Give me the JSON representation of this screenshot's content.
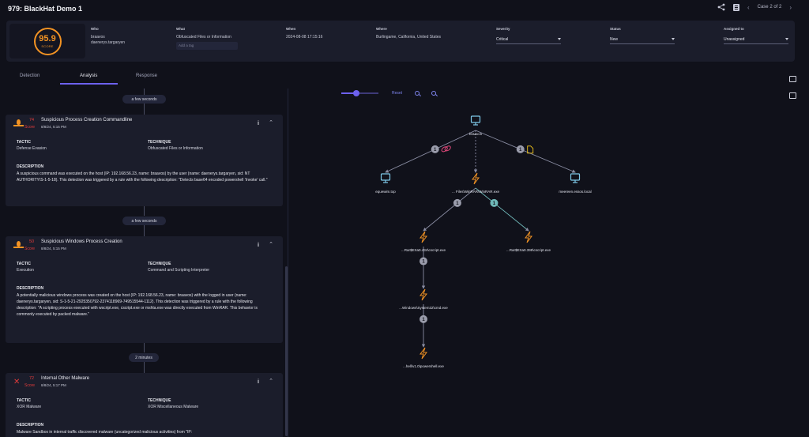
{
  "header": {
    "title": "979: BlackHat Demo 1",
    "case_nav": "Case 2 of 2"
  },
  "summary": {
    "score": "95.9",
    "score_label": "SCORE",
    "who_label": "Who",
    "who_values": [
      "braavos",
      "daenerys.targaryen"
    ],
    "what_label": "What",
    "what_value": "Obfuscated Files or Information",
    "tag_placeholder": "Add a tag",
    "when_label": "When",
    "when_value": "2024-08-08 17:15:16",
    "where_label": "Where",
    "where_value": "Burlingame, California, United States",
    "severity_label": "Severity",
    "severity_value": "Critical",
    "status_label": "Status",
    "status_value": "New",
    "assigned_label": "Assigned to",
    "assigned_value": "Unassigned"
  },
  "tabs": [
    "Detection",
    "Analysis",
    "Response"
  ],
  "active_tab": "Analysis",
  "timeline": {
    "gaps": [
      "a few seconds",
      "a few seconds",
      "2 minutes"
    ],
    "cards": [
      {
        "icon": "flame-icon",
        "score": "74",
        "score_label": "Score",
        "name": "Suspicious Process Creation Commandline",
        "time": "8/8/24, 5:15 PM",
        "tactic_label": "TACTIC",
        "tactic": "Defense Evasion",
        "technique_label": "TECHNIQUE",
        "technique": "Obfuscated Files or Information",
        "description_label": "DESCRIPTION",
        "description": "A suspicious command was executed on the host (IP: 192.168.56.23, name: braavos) by the user (name: daenerys.targaryen, sid: NT AUTHORITY\\S-1-5-18). This detection was triggered by a rule with the following description: \"Detects base64 encoded powershell 'Invoke' call.\""
      },
      {
        "icon": "flame-icon",
        "score": "50",
        "score_label": "Score",
        "name": "Suspicious Windows Process Creation",
        "time": "8/8/24, 5:15 PM",
        "tactic_label": "TACTIC",
        "tactic": "Execution",
        "technique_label": "TECHNIQUE",
        "technique": "Command and Scripting Interpreter",
        "description_label": "DESCRIPTION",
        "description": "A potentially malicious windows process was created on the host (IP: 192.168.56.23, name: braavos) with the logged in user (name: daenerys.targaryen, sid: S-1-5-21-2925350792-2374118969-749515544-1112). This detection was triggered by a rule with the following description: \"A scripting process executed with wscript.exe, cscript.exe or mshta.exe was directly executed from WinRAR. This behavior is commonly executed by packed malware.\""
      },
      {
        "icon": "malware-icon",
        "score": "72",
        "score_label": "Score",
        "name": "Internal Other Malware",
        "time": "8/8/24, 5:17 PM",
        "tactic_label": "TACTIC",
        "tactic": "XOR Malware",
        "technique_label": "TECHNIQUE",
        "technique": "XOR Miscellaneous Malware",
        "description_label": "DESCRIPTION",
        "description": "Malware Sandbox in internal traffic discovered malware (uncategorized malicious activities) from \"IP:"
      }
    ]
  },
  "graph": {
    "reset_label": "Reset",
    "nodes": [
      {
        "id": "braavos",
        "label": "braavos",
        "icon": "monitor-icon"
      },
      {
        "id": "qwewim",
        "label": "equewim.top",
        "icon": "monitor-icon"
      },
      {
        "id": "winrar",
        "label": "... Files\\WinRAR\\WinRAR.exe",
        "icon": "process-bolt-icon"
      },
      {
        "id": "meereen",
        "label": "meereen.essos.local",
        "icon": "monitor-icon"
      },
      {
        "id": "cscript1",
        "label": "...Rar$EXa0.434\\cscript.exe",
        "icon": "process-bolt-icon"
      },
      {
        "id": "cscript2",
        "label": "...Rar$EXa0.398\\cscript.exe",
        "icon": "process-bolt-icon"
      },
      {
        "id": "cmd",
        "label": "...Windows\\System32\\cmd.exe",
        "icon": "process-bolt-icon"
      },
      {
        "id": "powershell",
        "label": "...hell\\v1.0\\powershell.exe",
        "icon": "process-bolt-icon"
      }
    ],
    "edges": [
      {
        "from": "braavos",
        "to": "qwewim",
        "badge": "1",
        "extra_icon": "link-icon"
      },
      {
        "from": "braavos",
        "to": "winrar",
        "badge": "",
        "style": "dashed"
      },
      {
        "from": "braavos",
        "to": "meereen",
        "badge": "1",
        "extra_icon": "file-icon"
      },
      {
        "from": "winrar",
        "to": "cscript1",
        "badge": "1"
      },
      {
        "from": "winrar",
        "to": "cscript2",
        "badge": "1",
        "highlight": true
      },
      {
        "from": "cscript1",
        "to": "cmd",
        "badge": "1"
      },
      {
        "from": "cmd",
        "to": "powershell",
        "badge": "1"
      }
    ]
  },
  "colors": {
    "accent": "#6d61ee",
    "score_orange": "#f39323",
    "danger_red": "#e03b3b",
    "node_blue": "#7ec8e8",
    "highlight_teal": "#6fb8b8"
  }
}
